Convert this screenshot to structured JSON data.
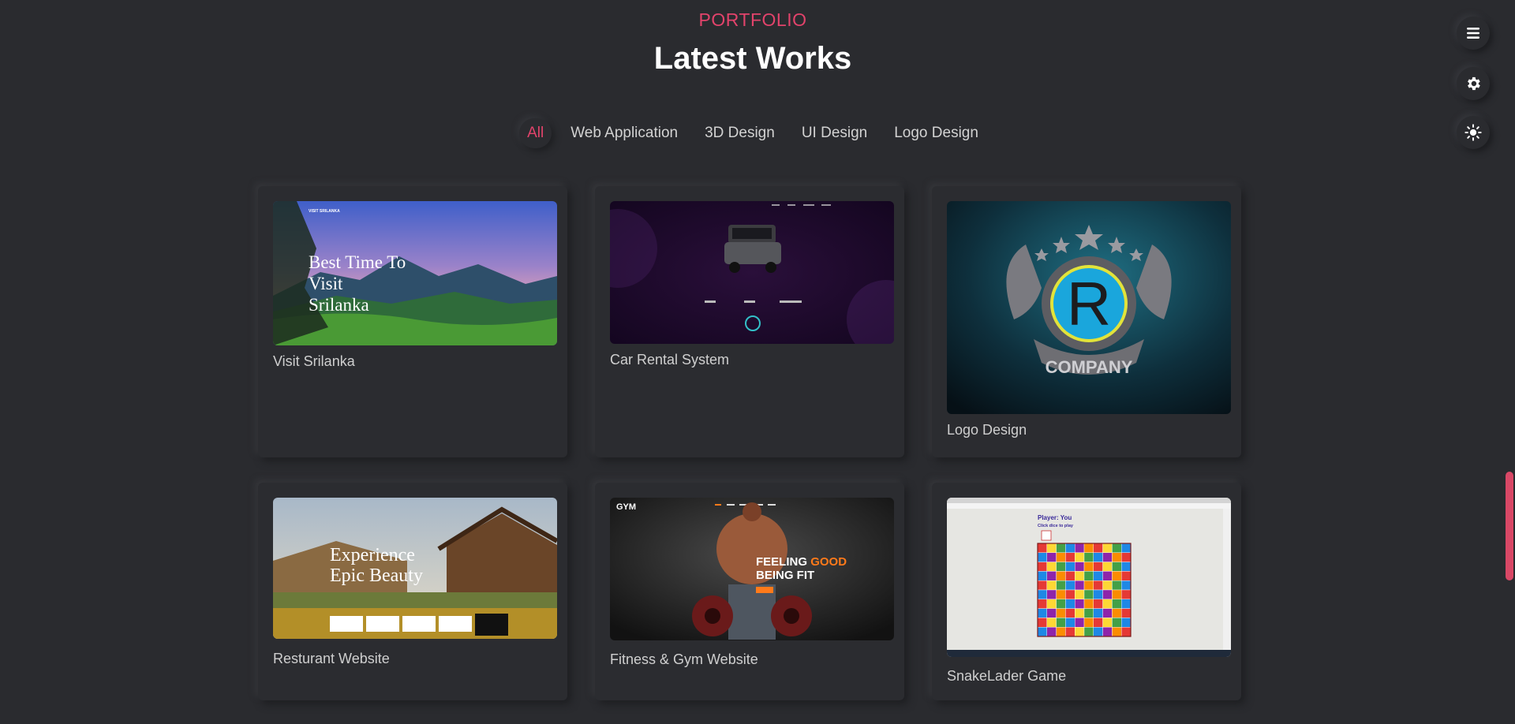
{
  "header": {
    "subtitle": "PORTFOLIO",
    "title": "Latest Works"
  },
  "filters": [
    {
      "label": "All",
      "active": true
    },
    {
      "label": "Web Application"
    },
    {
      "label": "3D Design"
    },
    {
      "label": "UI Design"
    },
    {
      "label": "Logo Design"
    }
  ],
  "side_controls": [
    {
      "icon": "menu-icon"
    },
    {
      "icon": "gear-icon"
    },
    {
      "icon": "sun-icon"
    }
  ],
  "projects": [
    {
      "title": "Visit Srilanka",
      "thumb": {
        "nav_brand": "VISIT SRILANKA",
        "headline": "Best Time To Visit Srilanka"
      }
    },
    {
      "title": "Car Rental System"
    },
    {
      "title": "Logo Design",
      "thumb": {
        "logo_letter": "R",
        "logo_text": "COMPANY"
      }
    },
    {
      "title": "Resturant Website",
      "thumb": {
        "headline": "Experience Epic Beauty"
      }
    },
    {
      "title": "Fitness & Gym Website",
      "thumb": {
        "brand": "GYM",
        "headline_1": "FEELING",
        "headline_accent": "GOOD",
        "headline_2": "BEING FIT"
      }
    },
    {
      "title": "SnakeLader Game",
      "thumb": {
        "player_text": "Player: You",
        "instruction": "Click dice to play"
      }
    }
  ],
  "colors": {
    "accent": "#e2436b",
    "background": "#2a2b2f"
  }
}
